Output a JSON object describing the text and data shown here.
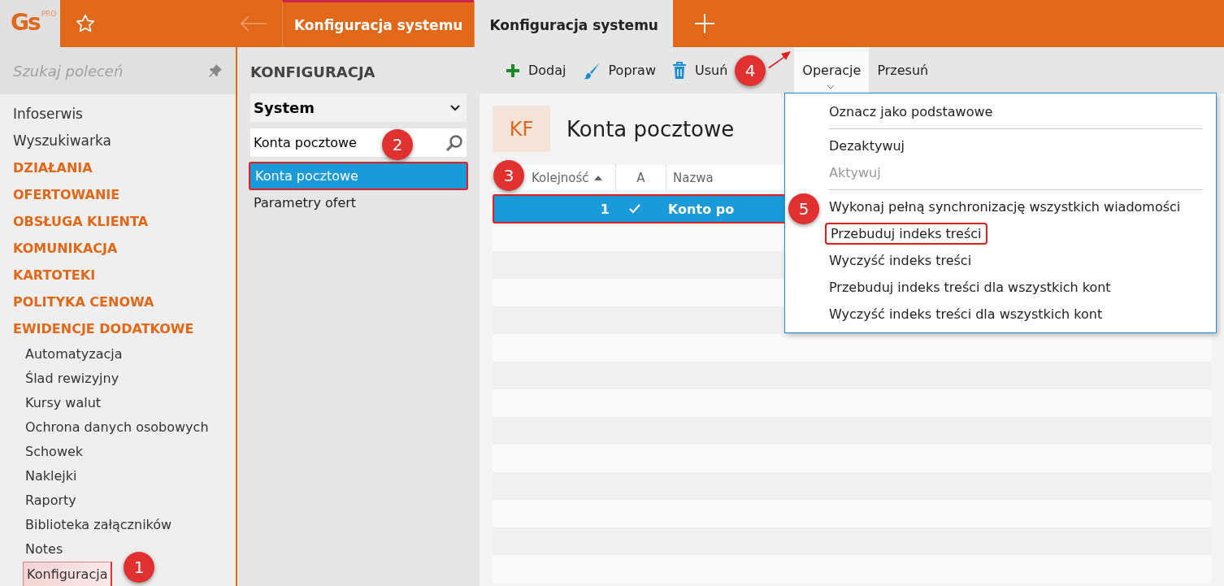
{
  "app": {
    "logo": "Gs",
    "logo_badge": "PRO"
  },
  "tabs": [
    {
      "label": "Konfiguracja systemu",
      "selected": false
    },
    {
      "label": "Konfiguracja systemu",
      "selected": true
    }
  ],
  "sidebar": {
    "search": {
      "placeholder": "Szukaj poleceń"
    },
    "items": [
      {
        "label": "Infoserwis",
        "kind": "link",
        "selected": false,
        "highlighted": false
      },
      {
        "label": "Wyszukiwarka",
        "kind": "link",
        "selected": false,
        "highlighted": false
      },
      {
        "label": "DZIAŁANIA",
        "kind": "section",
        "selected": false,
        "highlighted": false
      },
      {
        "label": "OFERTOWANIE",
        "kind": "section",
        "selected": false,
        "highlighted": false
      },
      {
        "label": "OBSŁUGA KLIENTA",
        "kind": "section",
        "selected": false,
        "highlighted": false
      },
      {
        "label": "KOMUNIKACJA",
        "kind": "section",
        "selected": false,
        "highlighted": false
      },
      {
        "label": "KARTOTEKI",
        "kind": "section",
        "selected": false,
        "highlighted": false
      },
      {
        "label": "POLITYKA CENOWA",
        "kind": "section",
        "selected": false,
        "highlighted": false
      },
      {
        "label": "EWIDENCJE DODATKOWE",
        "kind": "section",
        "selected": false,
        "highlighted": false
      },
      {
        "label": "Automatyzacja",
        "kind": "sub",
        "selected": false,
        "highlighted": false
      },
      {
        "label": "Ślad rewizyjny",
        "kind": "sub",
        "selected": false,
        "highlighted": false
      },
      {
        "label": "Kursy walut",
        "kind": "sub",
        "selected": false,
        "highlighted": false
      },
      {
        "label": "Ochrona danych osobowych",
        "kind": "sub",
        "selected": false,
        "highlighted": false
      },
      {
        "label": "Schowek",
        "kind": "sub",
        "selected": false,
        "highlighted": false
      },
      {
        "label": "Naklejki",
        "kind": "sub",
        "selected": false,
        "highlighted": false
      },
      {
        "label": "Raporty",
        "kind": "sub",
        "selected": false,
        "highlighted": false
      },
      {
        "label": "Biblioteka załączników",
        "kind": "sub",
        "selected": false,
        "highlighted": false
      },
      {
        "label": "Notes",
        "kind": "sub",
        "selected": false,
        "highlighted": false
      },
      {
        "label": "Konfiguracja",
        "kind": "sub",
        "selected": true,
        "highlighted": true
      }
    ]
  },
  "config_panel": {
    "title": "KONFIGURACJA",
    "group": "System",
    "search": {
      "value": "Konta pocztowe"
    },
    "items": [
      {
        "label": "Konta pocztowe",
        "selected": true,
        "highlighted": true
      },
      {
        "label": "Parametry ofert",
        "selected": false,
        "highlighted": false
      }
    ]
  },
  "toolbar": [
    {
      "label": "Dodaj",
      "kind": "add"
    },
    {
      "label": "Popraw",
      "kind": "edit"
    },
    {
      "label": "Usuń",
      "kind": "delete"
    },
    {
      "label": "Operacje",
      "kind": "menu"
    },
    {
      "label": "Przesuń",
      "kind": "plain"
    }
  ],
  "header": {
    "badge": "KF",
    "title": "Konta pocztowe"
  },
  "table": {
    "columns": [
      "Kolejność",
      "A",
      "Nazwa"
    ],
    "rows": [
      {
        "order": "1",
        "active": true,
        "name": "Konto po",
        "selected": true,
        "highlighted": true
      }
    ]
  },
  "operations_menu": [
    {
      "kind": "item",
      "label": "Oznacz jako podstawowe",
      "disabled": false,
      "highlighted": false
    },
    {
      "kind": "separator"
    },
    {
      "kind": "item",
      "label": "Dezaktywuj",
      "disabled": false,
      "highlighted": false
    },
    {
      "kind": "item",
      "label": "Aktywuj",
      "disabled": true,
      "highlighted": false
    },
    {
      "kind": "separator"
    },
    {
      "kind": "item",
      "label": "Wykonaj pełną synchronizację wszystkich wiadomości",
      "disabled": false,
      "highlighted": false
    },
    {
      "kind": "item",
      "label": "Przebuduj indeks treści",
      "disabled": false,
      "highlighted": true
    },
    {
      "kind": "item",
      "label": "Wyczyść indeks treści",
      "disabled": false,
      "highlighted": false
    },
    {
      "kind": "item",
      "label": "Przebuduj indeks treści dla wszystkich kont",
      "disabled": false,
      "highlighted": false
    },
    {
      "kind": "item",
      "label": "Wyczyść indeks treści dla wszystkich kont",
      "disabled": false,
      "highlighted": false
    }
  ],
  "callouts": [
    "1",
    "2",
    "3",
    "4",
    "5"
  ]
}
